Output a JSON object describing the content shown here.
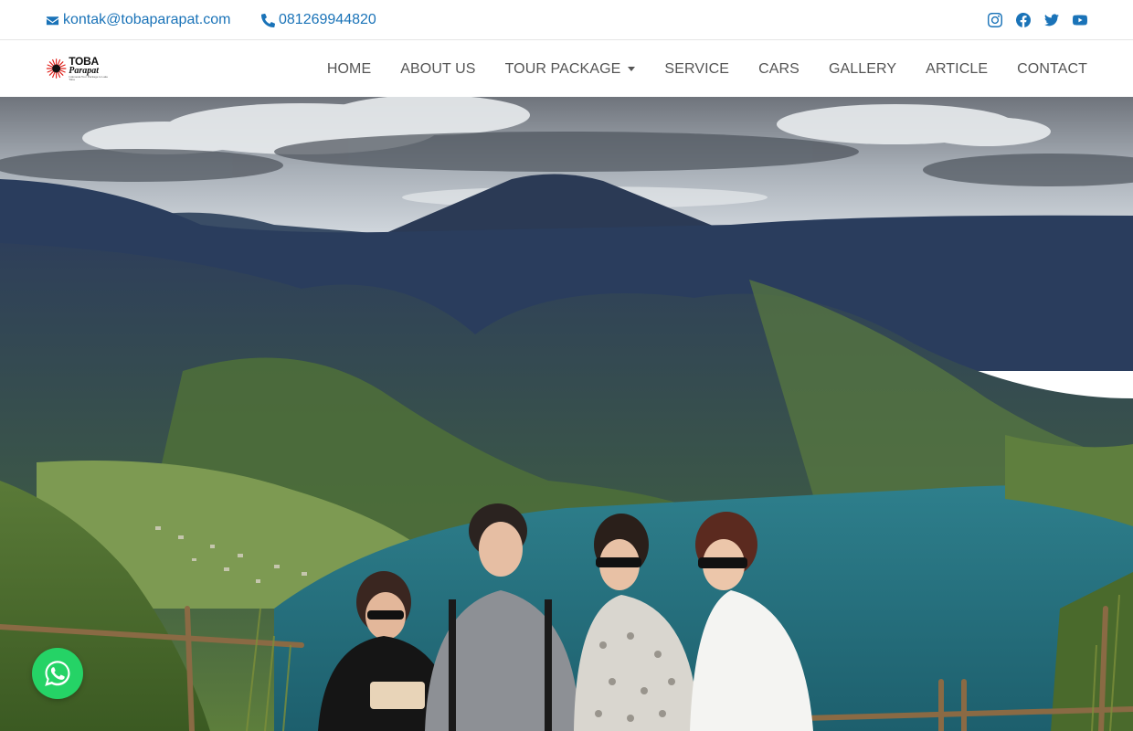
{
  "topbar": {
    "email": "kontak@tobaparapat.com",
    "phone": "081269944820",
    "social": [
      "instagram-icon",
      "facebook-icon",
      "twitter-icon",
      "youtube-icon"
    ]
  },
  "brand": {
    "line1": "TOBA",
    "line2": "Parapat",
    "tagline": "Indonesia Tour Package to Lake Toba"
  },
  "nav": {
    "items": [
      {
        "label": "HOME"
      },
      {
        "label": "ABOUT US"
      },
      {
        "label": "TOUR PACKAGE",
        "has_dropdown": true
      },
      {
        "label": "SERVICE"
      },
      {
        "label": "CARS"
      },
      {
        "label": "GALLERY"
      },
      {
        "label": "ARTICLE"
      },
      {
        "label": "CONTACT"
      }
    ]
  },
  "colors": {
    "accent": "#1a73b8",
    "nav_text": "#555555",
    "whatsapp": "#25d366"
  },
  "hero": {
    "image": "lake-toba-panorama-with-four-tourists"
  },
  "whatsapp": {
    "icon": "whatsapp-icon"
  }
}
